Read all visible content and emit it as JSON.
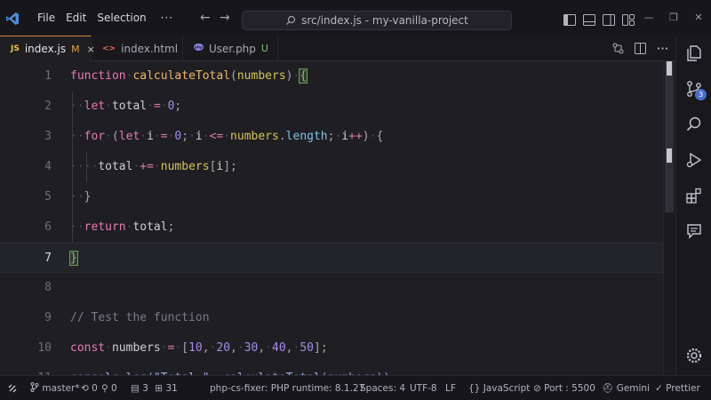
{
  "menu": [
    "File",
    "Edit",
    "Selection",
    "···"
  ],
  "command_center": {
    "label": "src/index.js - my-vanilla-project"
  },
  "tabs": [
    {
      "icon": "JS",
      "label": "index.js",
      "git_state": "M",
      "close": "×",
      "active": true,
      "icon_color": "#e8c548",
      "state_color": "#e2a445"
    },
    {
      "icon": "<>",
      "label": "index.html",
      "git_state": "",
      "active": false,
      "icon_color": "#e06d4b"
    },
    {
      "icon": "php",
      "label": "User.php",
      "git_state": "U",
      "active": false,
      "icon_color": "#8f87e6",
      "state_color": "#86c36b"
    }
  ],
  "editor": {
    "current_line": 7,
    "line_numbers": [
      "1",
      "2",
      "3",
      "4",
      "5",
      "6",
      "7",
      "8",
      "9",
      "10",
      "11"
    ],
    "lines": {
      "l1": {
        "kw": "function",
        "fn": "calculateTotal",
        "open": "(",
        "param": "numbers",
        "close": ")",
        "brace": "{"
      },
      "l2": {
        "kw": "let",
        "id": "total",
        "op": "=",
        "num": "0",
        "semi": ";"
      },
      "l3": {
        "kw": "for",
        "p1": "(",
        "kw2": "let",
        "i1": "i",
        "op1": "=",
        "n1": "0",
        "s1": ";",
        "i2": "i",
        "op2": "<=",
        "arr": "numbers",
        "dot": ".",
        "prop": "length",
        "s2": ";",
        "i3": "i",
        "op3": "++",
        "p2": ")",
        "brace": "{"
      },
      "l4": {
        "id": "total",
        "op": "+=",
        "arr": "numbers",
        "b1": "[",
        "i": "i",
        "b2": "]",
        "semi": ";"
      },
      "l5": {
        "brace": "}"
      },
      "l6": {
        "kw": "return",
        "id": "total",
        "semi": ";"
      },
      "l7": {
        "brace": "}"
      },
      "l9": {
        "comment": "// Test the function"
      },
      "l10": {
        "kw": "const",
        "id": "numbers",
        "op": "=",
        "b1": "[",
        "n1": "10",
        "n2": "20",
        "n3": "30",
        "n4": "40",
        "n5": "50",
        "b2": "]",
        "semi": ";",
        "comma": ","
      },
      "l11": {
        "text": "console.log(\"Total:\", calculateTotal(numbers));"
      }
    }
  },
  "activity": {
    "scm_badge": "3"
  },
  "status": {
    "branch": "master*",
    "sync": "0",
    "problems": "3",
    "added": "31",
    "php": "php-cs-fixer: PHP runtime: 8.1.27",
    "spaces": "Spaces: 4",
    "encoding": "UTF-8",
    "eol": "LF",
    "language": "JavaScript",
    "port": "Port : 5500",
    "gemini": "Gemini",
    "prettier": "Prettier"
  },
  "colors": {
    "accent": "#d98b38",
    "badge": "#4b6ec9",
    "background": "#1e1e23"
  }
}
